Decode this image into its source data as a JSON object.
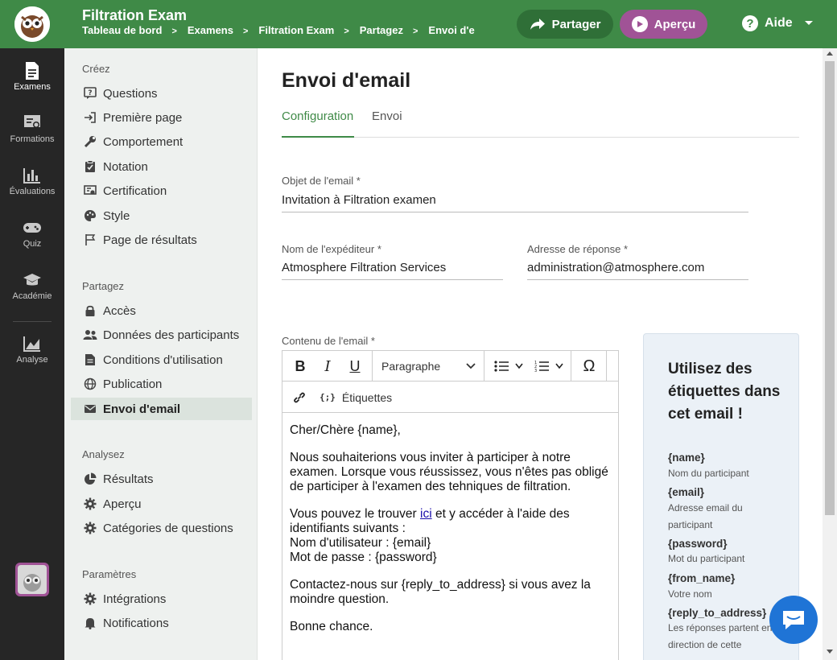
{
  "header": {
    "app_title": "Filtration Exam",
    "breadcrumb": [
      "Tableau de bord",
      "Examens",
      "Filtration Exam",
      "Partagez",
      "Envoi d'email"
    ],
    "share_label": "Partager",
    "preview_label": "Aperçu",
    "help_label": "Aide",
    "colors": {
      "bar": "#3f8a47",
      "share": "#2f6f37",
      "preview": "#a05396"
    }
  },
  "rail": {
    "items": [
      {
        "label": "Examens",
        "icon": "document-icon",
        "active": true
      },
      {
        "label": "Formations",
        "icon": "certificate-icon"
      },
      {
        "label": "Évaluations",
        "icon": "bar-chart-icon"
      },
      {
        "label": "Quiz",
        "icon": "gamepad-icon"
      },
      {
        "label": "Académie",
        "icon": "graduation-cap-icon"
      },
      {
        "label": "Analyse",
        "icon": "line-chart-icon"
      }
    ]
  },
  "sidebar": {
    "sections": [
      {
        "title": "Créez",
        "items": [
          {
            "label": "Questions",
            "icon": "question-box-icon"
          },
          {
            "label": "Première page",
            "icon": "sign-in-icon"
          },
          {
            "label": "Comportement",
            "icon": "wrench-icon"
          },
          {
            "label": "Notation",
            "icon": "clipboard-check-icon"
          },
          {
            "label": "Certification",
            "icon": "certificate-icon"
          },
          {
            "label": "Style",
            "icon": "palette-icon"
          },
          {
            "label": "Page de résultats",
            "icon": "flag-icon"
          }
        ]
      },
      {
        "title": "Partagez",
        "items": [
          {
            "label": "Accès",
            "icon": "lock-icon"
          },
          {
            "label": "Données des participants",
            "icon": "users-icon"
          },
          {
            "label": "Conditions d'utilisation",
            "icon": "document-icon"
          },
          {
            "label": "Publication",
            "icon": "globe-icon"
          },
          {
            "label": "Envoi d'email",
            "icon": "envelope-icon",
            "active": true
          }
        ]
      },
      {
        "title": "Analysez",
        "items": [
          {
            "label": "Résultats",
            "icon": "pie-chart-icon"
          },
          {
            "label": "Aperçu",
            "icon": "gear-icon"
          },
          {
            "label": "Catégories de questions",
            "icon": "gear-icon"
          }
        ]
      },
      {
        "title": "Paramètres",
        "items": [
          {
            "label": "Intégrations",
            "icon": "gear-icon"
          },
          {
            "label": "Notifications",
            "icon": "bell-icon"
          }
        ]
      }
    ]
  },
  "main": {
    "title": "Envoi d'email",
    "tabs": [
      {
        "label": "Configuration",
        "active": true
      },
      {
        "label": "Envoi"
      }
    ],
    "subject": {
      "label": "Objet de l'email *",
      "value": "Invitation à Filtration examen"
    },
    "sender": {
      "label": "Nom de l'expéditeur *",
      "value": "Atmosphere Filtration Services"
    },
    "reply": {
      "label": "Adresse de réponse *",
      "value": "administration@atmosphere.com"
    },
    "content_label": "Contenu de l'email *",
    "toolbar": {
      "paragraph": "Paragraphe",
      "labels": "Étiquettes"
    },
    "body": {
      "greeting": "Cher/Chère {name},",
      "p1": "Nous souhaiterions vous inviter à participer à notre examen. Lorsque vous réussissez, vous n'êtes pas obligé de participer à l'examen des tehniques de filtration.",
      "p2_before": "Vous pouvez le trouver ",
      "p2_link": "ici",
      "p2_after": " et y accéder à l'aide des identifiants suivants :",
      "p2_user": "Nom d'utilisateur : {email}",
      "p2_pass": "Mot de passe : {password}",
      "p3": "Contactez-nous sur {reply_to_address} si vous avez la moindre question.",
      "p4": "Bonne chance."
    }
  },
  "tags": {
    "title": "Utilisez des étiquettes dans cet email !",
    "items": [
      {
        "name": "{name}",
        "desc": "Nom du participant"
      },
      {
        "name": "{email}",
        "desc": "Adresse email du participant"
      },
      {
        "name": "{password}",
        "desc": "Mot du participant"
      },
      {
        "name": "{from_name}",
        "desc": "Votre nom"
      },
      {
        "name": "{reply_to_address}",
        "desc": "Les réponses partent en direction de cette"
      }
    ]
  }
}
